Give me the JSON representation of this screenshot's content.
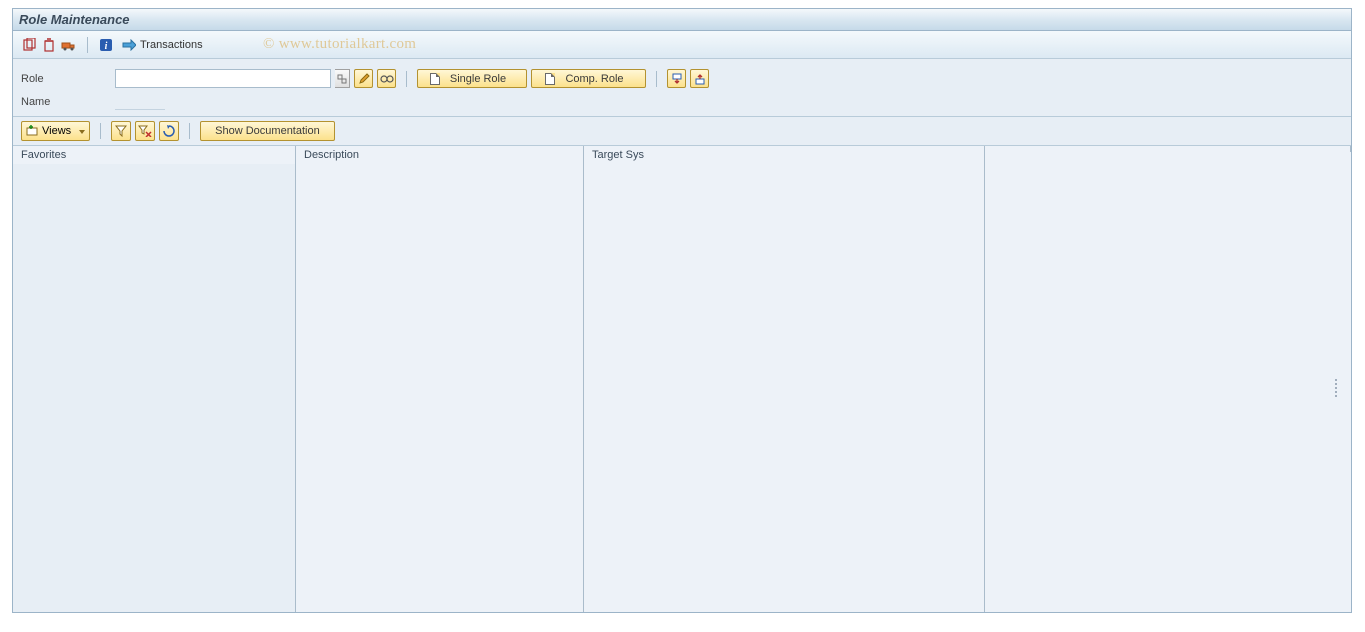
{
  "window": {
    "title": "Role Maintenance"
  },
  "toolbar": {
    "transactions_label": "Transactions",
    "watermark": "© www.tutorialkart.com"
  },
  "form": {
    "role_label": "Role",
    "role_value": "",
    "name_label": "Name",
    "name_value": ""
  },
  "buttons": {
    "single_role": "Single Role",
    "comp_role": "Comp. Role",
    "views": "Views",
    "show_documentation": "Show Documentation"
  },
  "icons": {
    "copy": "copy-icon",
    "delete": "delete-icon",
    "transport": "transport-icon",
    "info": "info-icon",
    "tx_arrow": "transactions-icon",
    "search_help": "search-help-icon",
    "edit": "pencil-icon",
    "display": "glasses-icon",
    "download": "download-icon",
    "upload": "upload-icon",
    "views_plus": "views-icon",
    "filter": "filter-icon",
    "filter_delete": "filter-delete-icon",
    "refresh": "refresh-icon"
  },
  "table": {
    "columns": {
      "favorites": "Favorites",
      "description": "Description",
      "target_sys": "Target Sys"
    },
    "rows": []
  }
}
